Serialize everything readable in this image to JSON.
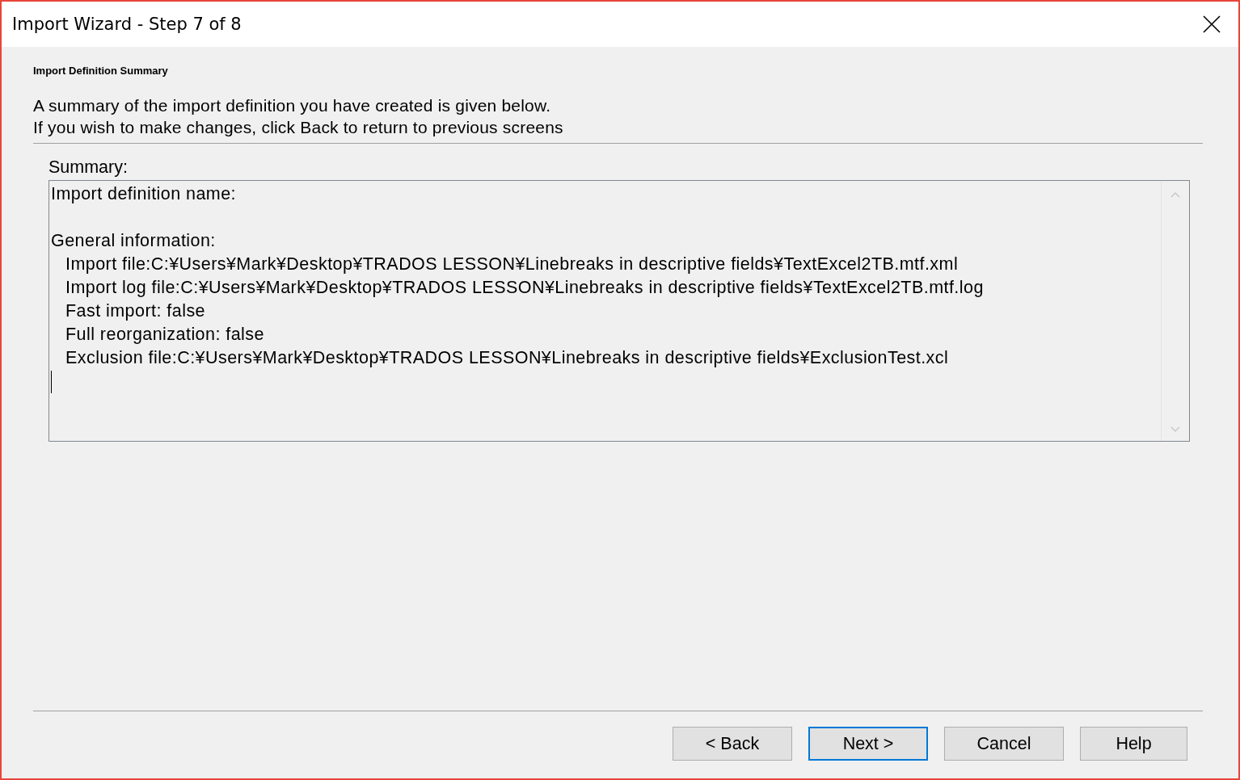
{
  "window": {
    "title": "Import Wizard - Step 7 of 8"
  },
  "page": {
    "heading": "Import Definition Summary",
    "description": [
      "A summary of the import definition you have created is given below.",
      "If you wish to make changes, click Back to return to previous screens"
    ]
  },
  "summary": {
    "label": "Summary:",
    "sections": [
      {
        "title": "Import definition name:"
      },
      {
        "title": "General information:",
        "items": [
          "Import file:C:¥Users¥Mark¥Desktop¥TRADOS LESSON¥Linebreaks in descriptive fields¥TextExcel2TB.mtf.xml",
          "Import log file:C:¥Users¥Mark¥Desktop¥TRADOS LESSON¥Linebreaks in descriptive fields¥TextExcel2TB.mtf.log",
          "Fast import: false",
          "Full reorganization: false",
          "Exclusion file:C:¥Users¥Mark¥Desktop¥TRADOS LESSON¥Linebreaks in descriptive fields¥ExclusionTest.xcl"
        ]
      }
    ]
  },
  "buttons": [
    {
      "label": "< Back",
      "default": false
    },
    {
      "label": "Next >",
      "default": true
    },
    {
      "label": "Cancel",
      "default": false
    },
    {
      "label": "Help",
      "default": false
    }
  ]
}
